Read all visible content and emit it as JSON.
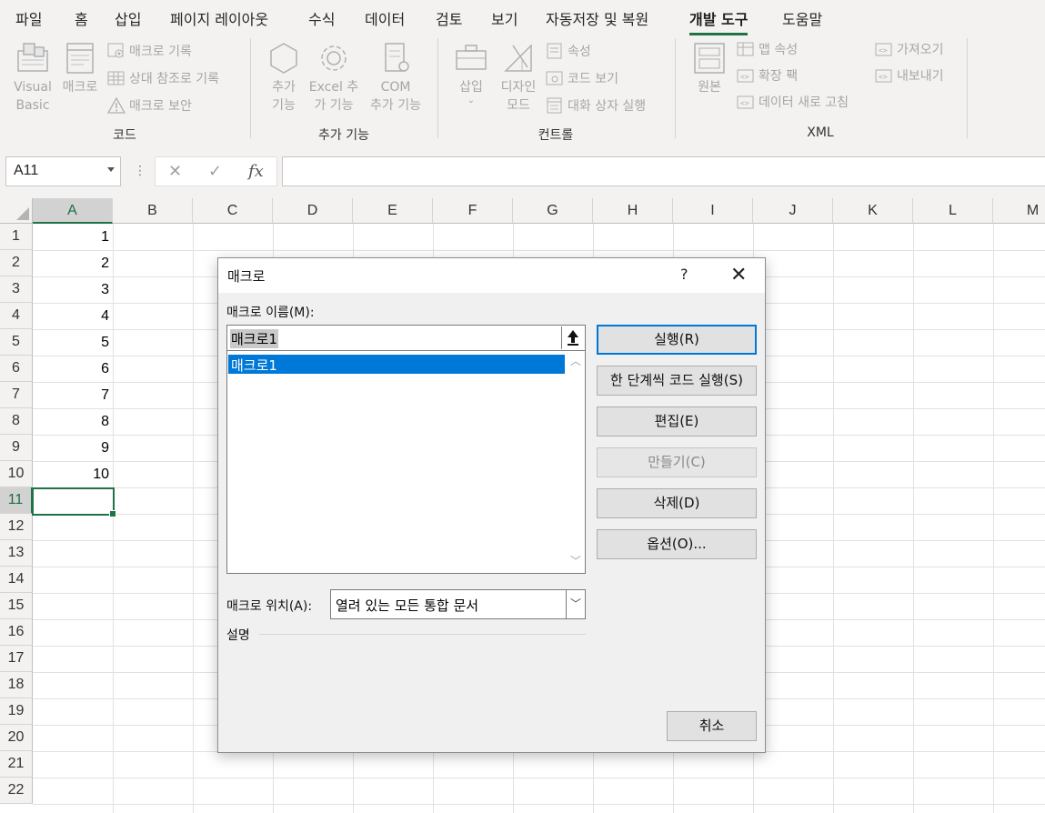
{
  "ribbon": {
    "tabs": [
      "파일",
      "홈",
      "삽입",
      "페이지 레이아웃",
      "수식",
      "데이터",
      "검토",
      "보기",
      "자동저장 및 복원",
      "개발 도구",
      "도움말"
    ],
    "active_tab": "개발 도구",
    "groups": {
      "code": {
        "label": "코드",
        "visual_basic": "Visual\nBasic",
        "macro": "매크로",
        "record_macro": "매크로 기록",
        "relative_ref": "상대 참조로 기록",
        "macro_security": "매크로 보안"
      },
      "addins": {
        "label": "추가 기능",
        "addins": "추가\n기능",
        "excel_addins": "Excel 추\n가 기능",
        "com_addins": "COM\n추가 기능"
      },
      "controls": {
        "label": "컨트롤",
        "insert": "삽입",
        "design_mode": "디자인\n모드",
        "properties": "속성",
        "view_code": "코드 보기",
        "run_dialog": "대화 상자 실행"
      },
      "xml": {
        "label": "XML",
        "source": "원본",
        "map_properties": "맵 속성",
        "expansion_packs": "확장 팩",
        "refresh_data": "데이터 새로 고침",
        "import": "가져오기",
        "export": "내보내기"
      }
    }
  },
  "formula_bar": {
    "name_box": "A11",
    "cancel_symbol": "✕",
    "enter_symbol": "✓",
    "fx_symbol": "fx",
    "formula": ""
  },
  "grid": {
    "columns": [
      "A",
      "B",
      "C",
      "D",
      "E",
      "F",
      "G",
      "H",
      "I",
      "J",
      "K",
      "L",
      "M"
    ],
    "rows": [
      "1",
      "2",
      "3",
      "4",
      "5",
      "6",
      "7",
      "8",
      "9",
      "10",
      "11",
      "12",
      "13",
      "14",
      "15",
      "16",
      "17",
      "18",
      "19",
      "20",
      "21",
      "22"
    ],
    "col_a_values": [
      "1",
      "2",
      "3",
      "4",
      "5",
      "6",
      "7",
      "8",
      "9",
      "10"
    ],
    "selected_column": "A",
    "selected_row": "11"
  },
  "dialog": {
    "title": "매크로",
    "help": "?",
    "close": "✕",
    "name_label": "매크로 이름(M):",
    "name_value": "매크로1",
    "list_items": [
      "매크로1"
    ],
    "buttons": {
      "run": "실행(R)",
      "step": "한 단계씩 코드 실행(S)",
      "edit": "편집(E)",
      "create": "만들기(C)",
      "delete": "삭제(D)",
      "options": "옵션(O)...",
      "cancel": "취소"
    },
    "location_label": "매크로 위치(A):",
    "location_value": "열려 있는 모든 통합 문서",
    "description_label": "설명"
  },
  "colors": {
    "accent": "#217346",
    "selection": "#0078d7"
  }
}
